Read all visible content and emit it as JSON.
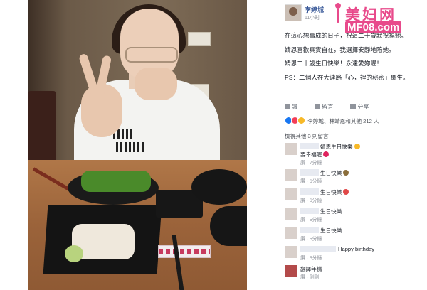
{
  "watermark": {
    "brand": "美妇网",
    "url": "MF08.com"
  },
  "post": {
    "author": "李婷城",
    "time": "11小时",
    "paragraphs": [
      "在這心想事成的日子，祝這二十歲默祝福她。",
      "婧恩喜歡真實自在，我選擇安靜地陪她。",
      "婧恩二十歲生日快樂！永遠愛妳喔！",
      "PS：二個人在大連路「心，裡的秘密」慶生。"
    ]
  },
  "actions": {
    "like": "讚",
    "comment": "留言",
    "share": "分享"
  },
  "reactions": {
    "icons": [
      "like-icon",
      "love-icon",
      "haha-icon"
    ],
    "summary": "李婷城、林靖恩和其他 212 人"
  },
  "comments_header": "檢視其他 3 則留言",
  "comments": [
    {
      "text": "婧恩生日快樂",
      "emoji": "smile-emoji",
      "emoji_color": "#f7b928",
      "extra": "要幸福喔",
      "extra_emoji": "heart-emoji",
      "extra_color": "#e0245e",
      "like": "讚",
      "time": "7分鐘"
    },
    {
      "text": "生日快樂",
      "emoji": "cake-emoji",
      "emoji_color": "#8a6d3b",
      "like": "讚",
      "time": "6分鐘"
    },
    {
      "text": "生日快樂",
      "emoji": "gift-emoji",
      "emoji_color": "#e04848",
      "like": "讚",
      "time": "6分鐘"
    },
    {
      "text": "生日快樂",
      "like": "讚",
      "time": "5分鐘"
    },
    {
      "text": "生日快樂",
      "like": "讚",
      "time": "5分鐘"
    },
    {
      "text": "Happy birthday",
      "like": "讚",
      "time": "5分鐘"
    },
    {
      "text": "翻譯年糕",
      "like": "讚",
      "time": "剛剛"
    }
  ]
}
